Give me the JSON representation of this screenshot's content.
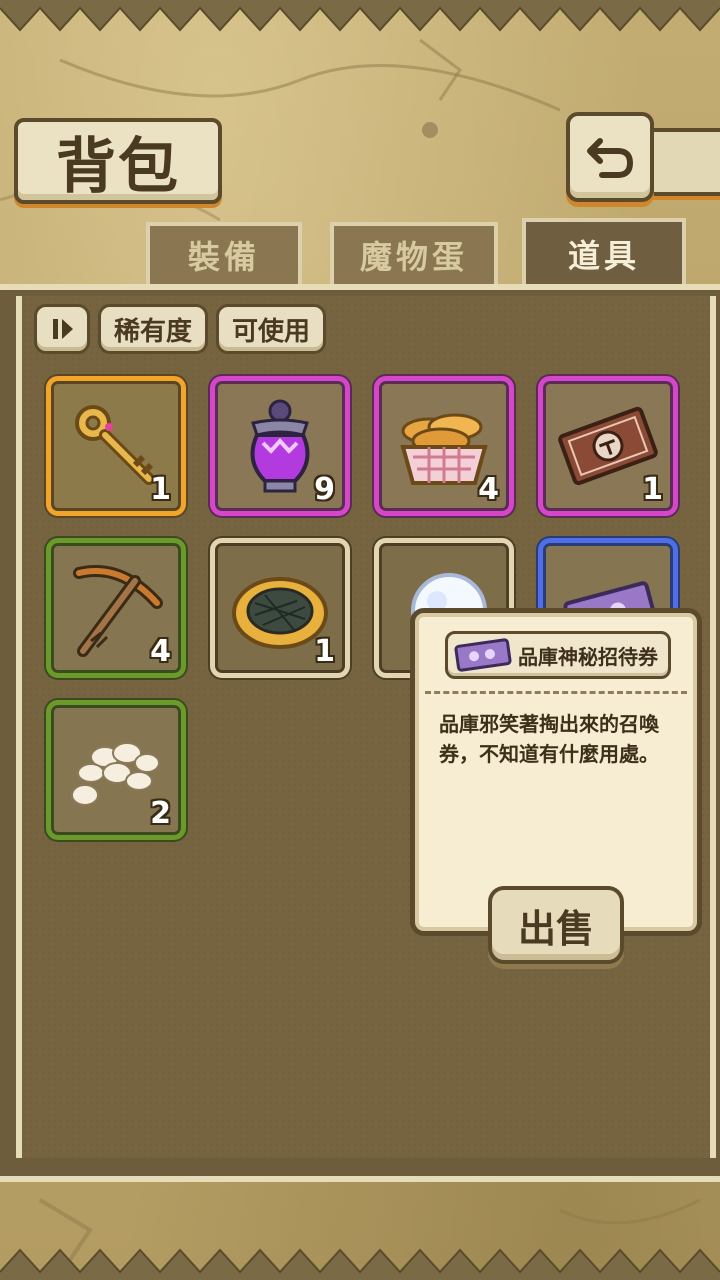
{
  "header": {
    "title": "背包"
  },
  "tabs": [
    {
      "label": "裝備",
      "active": false
    },
    {
      "label": "魔物蛋",
      "active": false
    },
    {
      "label": "道具",
      "active": true
    }
  ],
  "filters": {
    "sort_icon": "sort-toggle-icon",
    "rarity": "稀有度",
    "usable": "可使用"
  },
  "items": [
    {
      "name": "golden-key",
      "rarity_color": "#f3a52a",
      "qty": "1"
    },
    {
      "name": "purple-potion",
      "rarity_color": "#d646c8",
      "qty": "9"
    },
    {
      "name": "bread-basket",
      "rarity_color": "#d646c8",
      "qty": "4"
    },
    {
      "name": "summon-ticket",
      "rarity_color": "#d646c8",
      "qty": "1"
    },
    {
      "name": "pickaxe",
      "rarity_color": "#6c9a2a",
      "qty": "4"
    },
    {
      "name": "pie",
      "rarity_color": "#e2d6b2",
      "qty": "1"
    },
    {
      "name": "snowball",
      "rarity_color": "#e2d6b2",
      "qty": ""
    },
    {
      "name": "mystery-ticket",
      "rarity_color": "#4e6fe6",
      "qty": ""
    },
    {
      "name": "eggs",
      "rarity_color": "#6c9a2a",
      "qty": "2"
    }
  ],
  "tooltip": {
    "item_name": "品庫神秘招待券",
    "description": "品庫邪笑著掏出來的召喚券，不知道有什麼用處。",
    "sell_label": "出售"
  }
}
